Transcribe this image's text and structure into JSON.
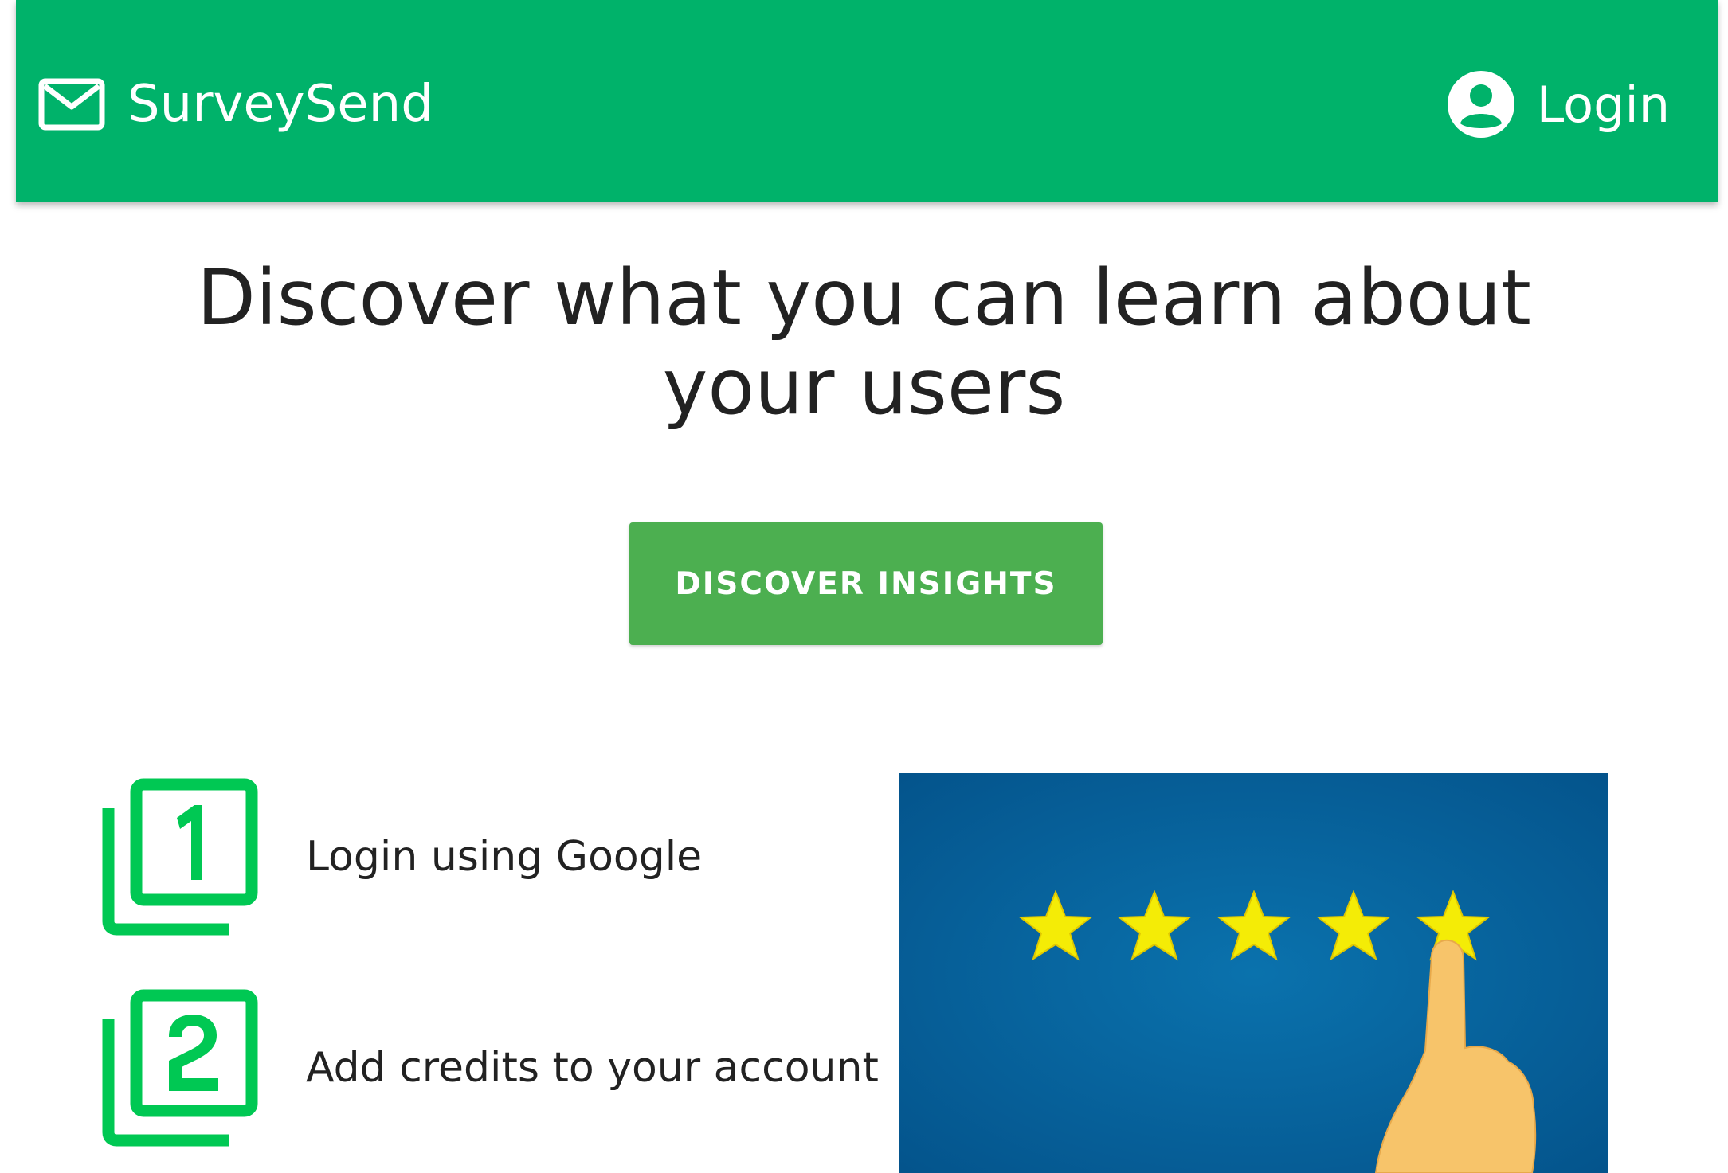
{
  "header": {
    "brand_name": "SurveySend",
    "brand_icon": "mail-icon",
    "login_label": "Login",
    "login_icon": "account-circle-icon",
    "bar_color": "#00b26a"
  },
  "hero": {
    "title_line1": "Discover what you can learn about",
    "title_line2": "your users",
    "cta_label": "DISCOVER INSIGHTS",
    "cta_color": "#4caf50"
  },
  "steps": [
    {
      "number": "1",
      "label": "Login using Google",
      "icon": "filter-1-icon"
    },
    {
      "number": "2",
      "label": "Add credits to your account",
      "icon": "filter-2-icon"
    }
  ],
  "promo": {
    "image": "five-star-rating-image",
    "rating": 5,
    "max_rating": 5,
    "background_color": "#0a5f96",
    "star_color": "#f4ec06"
  }
}
